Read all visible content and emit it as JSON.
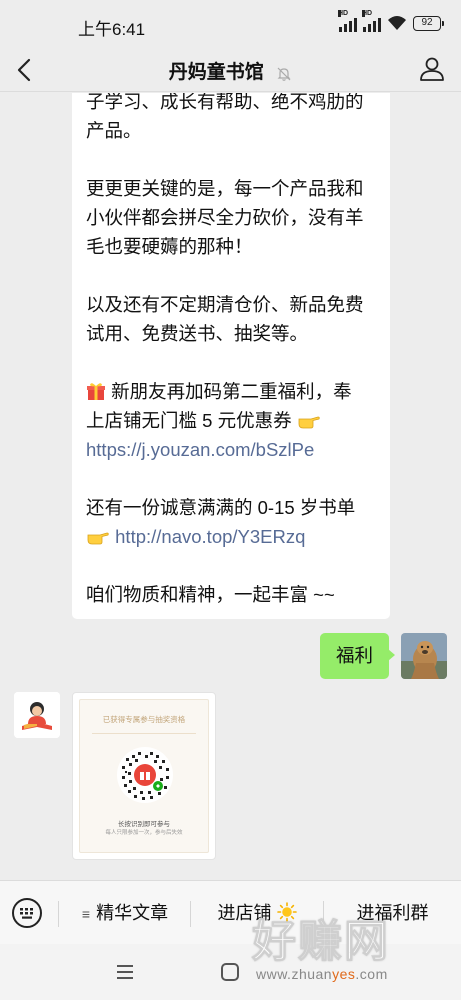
{
  "status_bar": {
    "time": "上午6:41",
    "signal_label": "HD",
    "battery": "92"
  },
  "header": {
    "back_icon": "chevron-left-icon",
    "title": "丹妈童书馆",
    "mute_icon": "bell-off-icon",
    "profile_icon": "person-icon"
  },
  "messages": {
    "incoming_text": {
      "lines": [
        "子学习、成长有帮助、绝不鸡肋的",
        "产品。",
        "",
        "更更更关键的是，每一个产品我和",
        "小伙伴都会拼尽全力砍价，没有羊",
        "毛也要硬薅的那种！",
        "",
        "以及还有不定期清仓价、新品免费",
        "试用、免费送书、抽奖等。",
        "",
        "新朋友再加码第二重福利，奉",
        "上店铺无门槛 5 元优惠券",
        "https://j.youzan.com/bSzlPe",
        "",
        "还有一份诚意满满的 0-15 岁书单",
        "http://navo.top/Y3ERzq",
        "",
        "咱们物质和精神，一起丰富 ~~"
      ],
      "link_color": "#576b95"
    },
    "outgoing": {
      "text": "福利",
      "bubble_color": "#95ec69"
    },
    "incoming_image": {
      "header": "已获得专属参与抽奖资格",
      "caption": "长按识别即可参与",
      "sub_caption": "每人只限参加一次，参与后失效"
    }
  },
  "menu": {
    "keyboard_icon": "keyboard-icon",
    "items": [
      {
        "prefix": "≡",
        "label": "精华文章"
      },
      {
        "label": "进店铺",
        "icon": "sun-icon"
      },
      {
        "label": "进福利群"
      }
    ]
  },
  "system_nav": {
    "menu_icon": "menu-icon",
    "home_icon": "home-icon"
  },
  "watermark": {
    "big": "好赚网",
    "url_prefix": "www.zhuan",
    "url_highlight": "yes",
    "url_suffix": ".com"
  }
}
